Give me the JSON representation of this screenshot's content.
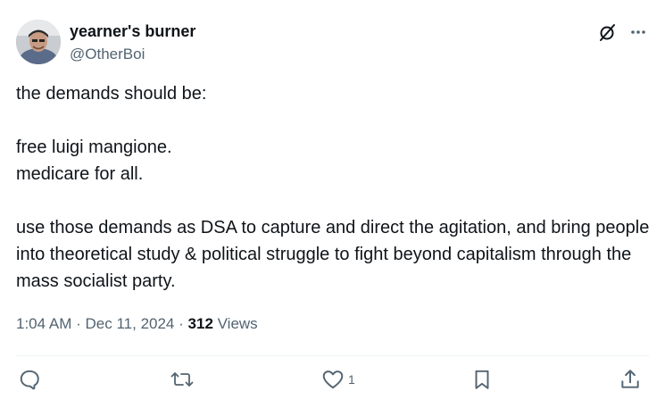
{
  "author": {
    "display_name": "yearner's burner",
    "handle": "@OtherBoi",
    "avatar_icon": "user-avatar"
  },
  "header_icons": [
    "grok-icon",
    "more-icon"
  ],
  "post": {
    "line_1": "the demands should be:",
    "line_2": "free luigi mangione.",
    "line_3": "medicare for all.",
    "line_4": "use those demands as DSA to capture and direct the agitation, and bring people into theoretical study & political struggle to fight beyond capitalism through the mass socialist party."
  },
  "meta": {
    "time": "1:04 AM",
    "separator": "·",
    "date": "Dec 11, 2024",
    "views_count": "312",
    "views_label": "Views"
  },
  "actions": {
    "reply_icon": "reply-icon",
    "repost_icon": "repost-icon",
    "like_icon": "heart-icon",
    "like_count": "1",
    "bookmark_icon": "bookmark-icon",
    "share_icon": "share-icon"
  },
  "colors": {
    "text_primary": "#0f1419",
    "text_secondary": "#536471",
    "divider": "#eff3f4"
  }
}
